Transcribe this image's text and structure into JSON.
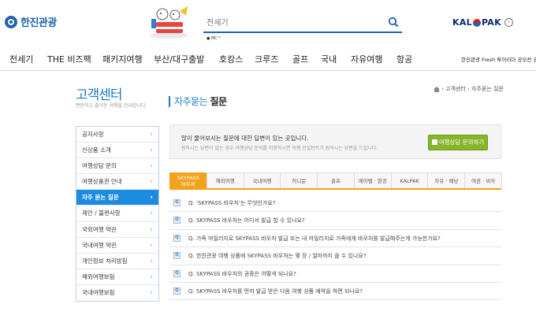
{
  "header": {
    "logo_text": "한진관광",
    "search_placeholder": "전세기",
    "mc_mark": "● MC™",
    "partner_logo": "KAL PAK"
  },
  "gnb": {
    "items": [
      "전세기",
      "THE 비즈팩",
      "패키지여행",
      "부산/대구출발",
      "호캉스",
      "크루즈",
      "골프",
      "국내",
      "자유여행",
      "항공"
    ],
    "extra": "한진관광 Fresh 투어리더 공모전 공고"
  },
  "customer_center": {
    "title": "고객센터",
    "subtitle": "편안하고 즐거운 여행을 안내합니다"
  },
  "page_title": {
    "light": "자주묻는 ",
    "bold": "질문"
  },
  "breadcrumb": "› 고객센터 › 자주묻는 질문",
  "side_menu": [
    {
      "label": "공지사항",
      "active": false
    },
    {
      "label": "신상품 소개",
      "active": false
    },
    {
      "label": "여행상담 문의",
      "active": false
    },
    {
      "label": "여행상품권 안내",
      "active": false
    },
    {
      "label": "자주 묻는 질문",
      "active": true
    },
    {
      "label": "제안 / 불편사항",
      "active": false
    },
    {
      "label": "국외여행 약관",
      "active": false
    },
    {
      "label": "국내여행 약관",
      "active": false
    },
    {
      "label": "개인정보 처리방침",
      "active": false
    },
    {
      "label": "해외여행보험",
      "active": false
    },
    {
      "label": "국내여행보험",
      "active": false
    }
  ],
  "info": {
    "main": "많이 물어보시는 질문에 대한 답변이 있는 곳입니다.",
    "sub": "원하시는 답변이 없는 경우 여행상담 문의를 이용하시면 여행 컨설턴트가 원하시는 답변을 드립니다.",
    "button": "여행상담 문의하기"
  },
  "tabs": [
    {
      "label": "SKYPASS\n바우처",
      "active": true
    },
    {
      "label": "해외여행",
      "active": false
    },
    {
      "label": "국내여행",
      "active": false
    },
    {
      "label": "허니문",
      "active": false
    },
    {
      "label": "골프",
      "active": false
    },
    {
      "label": "에어텔 · 항공",
      "active": false
    },
    {
      "label": "KALPAK",
      "active": false
    },
    {
      "label": "자유 · 배낭",
      "active": false
    },
    {
      "label": "여권 · 비자",
      "active": false
    }
  ],
  "faq_marker": "Q",
  "faqs": [
    "Q. 'SKYPASS 바우처'는 무엇인가요?",
    "Q. SKYPASS 바우처는 어디서 발급 할 수 있나요?",
    "Q. 가족 마일리지로 SKYPASS 바우처 발급 또는 내 마일리지로 가족에게 바우처를 발급해주는게 가능한가요?",
    "Q. 한진관광 여행 상품에 SKYPASS 바우처는 몇 장 / 얼마까지 쓸 수 있나요?",
    "Q. SKYPASS 바우처의 권종은 어떻게 되나요?",
    "Q. SKYPASS 바우처를 먼저 발급 받은 다음 여행 상품 예약을 하면 되나요?"
  ],
  "colors": {
    "brand_blue": "#1c63b0",
    "title_blue": "#1b7bc6",
    "active_menu": "#1d8be0",
    "tab_orange": "#f5a21b",
    "button_green": "#86b52b"
  }
}
